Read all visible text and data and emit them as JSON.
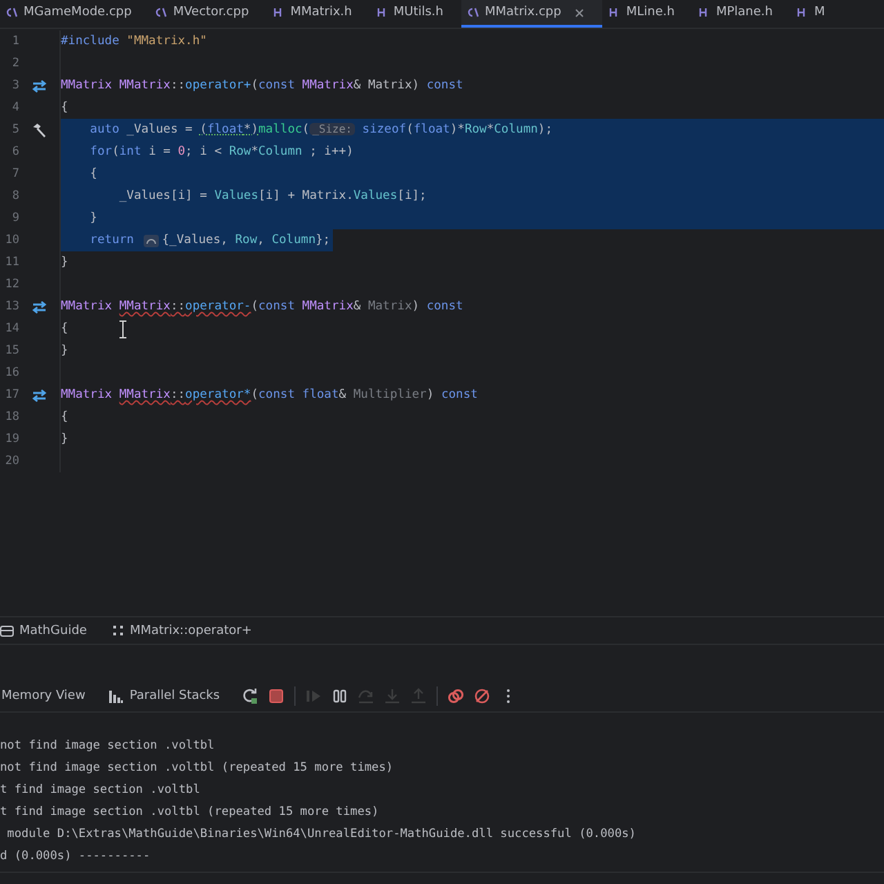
{
  "tabs": [
    {
      "label": "MGameMode.cpp",
      "kind": "cpp",
      "selected": false
    },
    {
      "label": "MVector.cpp",
      "kind": "cpp",
      "selected": false
    },
    {
      "label": "MMatrix.h",
      "kind": "h",
      "selected": false
    },
    {
      "label": "MUtils.h",
      "kind": "h",
      "selected": false
    },
    {
      "label": "MMatrix.cpp",
      "kind": "cpp",
      "selected": true
    },
    {
      "label": "MLine.h",
      "kind": "h",
      "selected": false
    },
    {
      "label": "MPlane.h",
      "kind": "h",
      "selected": false
    },
    {
      "label": "M",
      "kind": "h",
      "selected": false
    }
  ],
  "editor": {
    "lines": [
      {
        "number": "1",
        "selected": false,
        "tokens": [
          {
            "text": "#include ",
            "kind": "kw"
          },
          {
            "text": "\"MMatrix.h\"",
            "kind": "str"
          }
        ]
      },
      {
        "number": "2",
        "selected": false
      },
      {
        "number": "3",
        "selected": false,
        "gutter": {
          "kind": "swap"
        },
        "tokens": [
          {
            "text": "MMatrix ",
            "kind": "type"
          },
          {
            "text": "MMatrix",
            "kind": "type"
          },
          {
            "text": "::",
            "kind": "plain"
          },
          {
            "text": "operator+",
            "kind": "method"
          },
          {
            "text": "(",
            "kind": "plain"
          },
          {
            "text": "const ",
            "kind": "kw"
          },
          {
            "text": "MMatrix",
            "kind": "type"
          },
          {
            "text": "& Matrix) ",
            "kind": "plain"
          },
          {
            "text": "const",
            "kind": "kw"
          }
        ]
      },
      {
        "number": "4",
        "selected": false,
        "tokens": [
          {
            "text": "{",
            "kind": "plain"
          }
        ]
      },
      {
        "number": "5",
        "selected": true,
        "gutter": {
          "kind": "hammer"
        },
        "tokens": [
          {
            "text": "    auto ",
            "kind": "kw"
          },
          {
            "text": "_Values = ",
            "kind": "plain"
          },
          {
            "text": "(",
            "kind": "plain",
            "warning": true
          },
          {
            "text": "float",
            "kind": "kw",
            "warning": true
          },
          {
            "text": "*)",
            "kind": "plain",
            "warning": true
          },
          {
            "text": "malloc",
            "kind": "fn"
          },
          {
            "text": "(",
            "kind": "plain"
          },
          {
            "text": "_Size:",
            "kind": "hint"
          },
          {
            "text": " sizeof",
            "kind": "kw"
          },
          {
            "text": "(",
            "kind": "plain"
          },
          {
            "text": "float",
            "kind": "kw"
          },
          {
            "text": ")*",
            "kind": "plain"
          },
          {
            "text": "Row",
            "kind": "field"
          },
          {
            "text": "*",
            "kind": "plain"
          },
          {
            "text": "Column",
            "kind": "field"
          },
          {
            "text": ");",
            "kind": "plain"
          }
        ]
      },
      {
        "number": "6",
        "selected": true,
        "tokens": [
          {
            "text": "    for",
            "kind": "kw"
          },
          {
            "text": "(",
            "kind": "plain"
          },
          {
            "text": "int ",
            "kind": "kw"
          },
          {
            "text": "i = ",
            "kind": "plain"
          },
          {
            "text": "0",
            "kind": "num"
          },
          {
            "text": "; i < ",
            "kind": "plain"
          },
          {
            "text": "Row",
            "kind": "field"
          },
          {
            "text": "*",
            "kind": "plain"
          },
          {
            "text": "Column",
            "kind": "field"
          },
          {
            "text": " ; i++)",
            "kind": "plain"
          }
        ]
      },
      {
        "number": "7",
        "selected": true,
        "tokens": [
          {
            "text": "    {",
            "kind": "plain"
          }
        ]
      },
      {
        "number": "8",
        "selected": true,
        "tokens": [
          {
            "text": "        _Values[i] = ",
            "kind": "plain"
          },
          {
            "text": "Values",
            "kind": "field"
          },
          {
            "text": "[i] + Matrix.",
            "kind": "plain"
          },
          {
            "text": "Values",
            "kind": "field"
          },
          {
            "text": "[i];",
            "kind": "plain"
          }
        ]
      },
      {
        "number": "9",
        "selected": true,
        "tokens": [
          {
            "text": "    }",
            "kind": "plain"
          }
        ]
      },
      {
        "number": "10",
        "selected": true,
        "tokens": [
          {
            "text": "    return ",
            "kind": "kw"
          },
          {
            "kind": "icon"
          },
          {
            "text": "{_Values, ",
            "kind": "plain"
          },
          {
            "text": "Row",
            "kind": "field"
          },
          {
            "text": ", ",
            "kind": "plain"
          },
          {
            "text": "Column",
            "kind": "field"
          },
          {
            "text": "};",
            "kind": "plain"
          }
        ]
      },
      {
        "number": "11",
        "selected": false,
        "tokens": [
          {
            "text": "}",
            "kind": "plain"
          }
        ]
      },
      {
        "number": "12",
        "selected": false
      },
      {
        "number": "13",
        "selected": false,
        "gutter": {
          "kind": "swap"
        },
        "tokens": [
          {
            "text": "MMatrix ",
            "kind": "type"
          },
          {
            "text": "MMatrix",
            "kind": "type",
            "error": true
          },
          {
            "text": "::",
            "kind": "plain",
            "error": true
          },
          {
            "text": "operator-",
            "kind": "method",
            "error": true
          },
          {
            "text": "(",
            "kind": "plain"
          },
          {
            "text": "const ",
            "kind": "kw"
          },
          {
            "text": "MMatrix",
            "kind": "type"
          },
          {
            "text": "& ",
            "kind": "plain"
          },
          {
            "text": "Matrix",
            "kind": "unused"
          },
          {
            "text": ") ",
            "kind": "plain"
          },
          {
            "text": "const",
            "kind": "kw"
          }
        ]
      },
      {
        "number": "14",
        "selected": false,
        "tokens": [
          {
            "text": "{",
            "kind": "plain"
          }
        ]
      },
      {
        "number": "15",
        "selected": false,
        "tokens": [
          {
            "text": "}",
            "kind": "plain"
          }
        ]
      },
      {
        "number": "16",
        "selected": false
      },
      {
        "number": "17",
        "selected": false,
        "gutter": {
          "kind": "swap"
        },
        "tokens": [
          {
            "text": "MMatrix ",
            "kind": "type"
          },
          {
            "text": "MMatrix",
            "kind": "type",
            "error": true
          },
          {
            "text": "::",
            "kind": "plain",
            "error": true
          },
          {
            "text": "operator*",
            "kind": "method",
            "error": true
          },
          {
            "text": "(",
            "kind": "plain"
          },
          {
            "text": "const ",
            "kind": "kw"
          },
          {
            "text": "float",
            "kind": "kw"
          },
          {
            "text": "& ",
            "kind": "plain"
          },
          {
            "text": "Multiplier",
            "kind": "unused"
          },
          {
            "text": ") ",
            "kind": "plain"
          },
          {
            "text": "const",
            "kind": "kw"
          }
        ]
      },
      {
        "number": "18",
        "selected": false,
        "tokens": [
          {
            "text": "{",
            "kind": "plain"
          }
        ]
      },
      {
        "number": "19",
        "selected": false,
        "tokens": [
          {
            "text": "}",
            "kind": "plain"
          }
        ]
      },
      {
        "number": "20",
        "selected": false
      }
    ]
  },
  "breadcrumbs": [
    {
      "label": "MathGuide",
      "kind": "project"
    },
    {
      "label": "MMatrix::operator+",
      "kind": "function"
    }
  ],
  "debug_toolbar": {
    "tabs": [
      {
        "label": "Memory View",
        "kind": "plain"
      },
      {
        "label": "Parallel Stacks",
        "kind": "stacks"
      }
    ],
    "actions": [
      {
        "kind": "rerun",
        "disabled": false
      },
      {
        "kind": "stop",
        "disabled": false
      },
      {
        "kind": "resume",
        "disabled": true
      },
      {
        "kind": "pause",
        "disabled": false
      },
      {
        "kind": "step-over",
        "disabled": true
      },
      {
        "kind": "step-into",
        "disabled": true
      },
      {
        "kind": "step-out",
        "disabled": true
      },
      {
        "kind": "breakpoints",
        "disabled": false
      },
      {
        "kind": "mute",
        "disabled": false
      },
      {
        "kind": "more",
        "disabled": false
      }
    ]
  },
  "console": {
    "lines": [
      "not find image section .voltbl",
      "not find image section .voltbl (repeated 15 more times)",
      "t find image section .voltbl",
      "t find image section .voltbl (repeated 15 more times)",
      " module D:\\Extras\\MathGuide\\Binaries\\Win64\\UnrealEditor-MathGuide.dll successful (0.000s)",
      "d (0.000s) ----------"
    ]
  }
}
